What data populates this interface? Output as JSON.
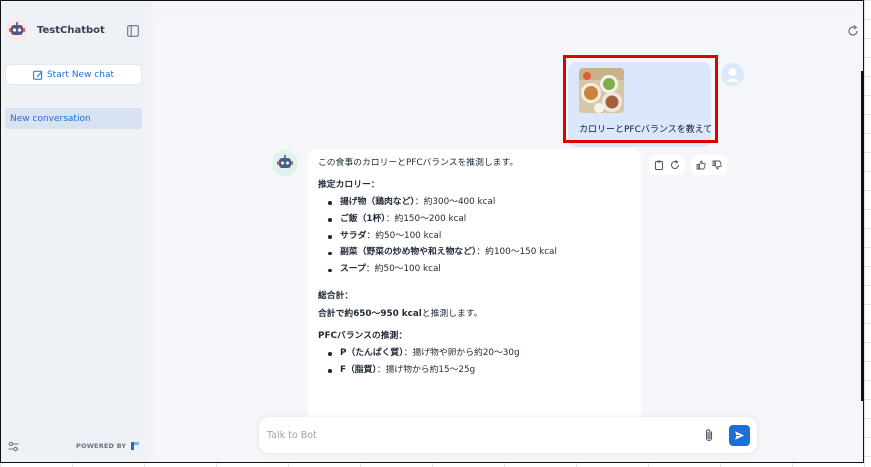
{
  "app": {
    "title": "TestChatbot"
  },
  "sidebar": {
    "new_chat_label": "Start New chat",
    "conversations": [
      {
        "label": "New conversation",
        "active": true
      }
    ],
    "powered_by": "POWERED BY"
  },
  "chat": {
    "user_message": {
      "text": "カロリーとPFCバランスを教えて",
      "has_image": true
    },
    "bot_message": {
      "intro": "この食事のカロリーとPFCバランスを推測します。",
      "calorie_heading": "推定カロリー：",
      "calorie_items": [
        {
          "name": "揚げ物（鶏肉など）",
          "value": "：約300～400 kcal"
        },
        {
          "name": "ご飯（1杯）",
          "value": "：約150～200 kcal"
        },
        {
          "name": "サラダ",
          "value": "：約50～100 kcal"
        },
        {
          "name": "副菜（野菜の炒め物や和え物など）",
          "value": "：約100～150 kcal"
        },
        {
          "name": "スープ",
          "value": "：約50～100 kcal"
        }
      ],
      "total_heading": "総合計：",
      "total_text_bold": "合計で約650～950 kcal",
      "total_text_rest": "と推測します。",
      "pfc_heading": "PFCバランスの推測：",
      "pfc_items": [
        {
          "name": "P（たんぱく質）",
          "value": "：揚げ物や卵から約20～30g"
        },
        {
          "name": "F（脂質）",
          "value": "：揚げ物から約15～25g"
        }
      ]
    }
  },
  "input": {
    "placeholder": "Talk to Bot"
  },
  "colors": {
    "accent": "#1d6fd6",
    "highlight": "#e00000",
    "user_bubble": "#dbe7fb"
  }
}
